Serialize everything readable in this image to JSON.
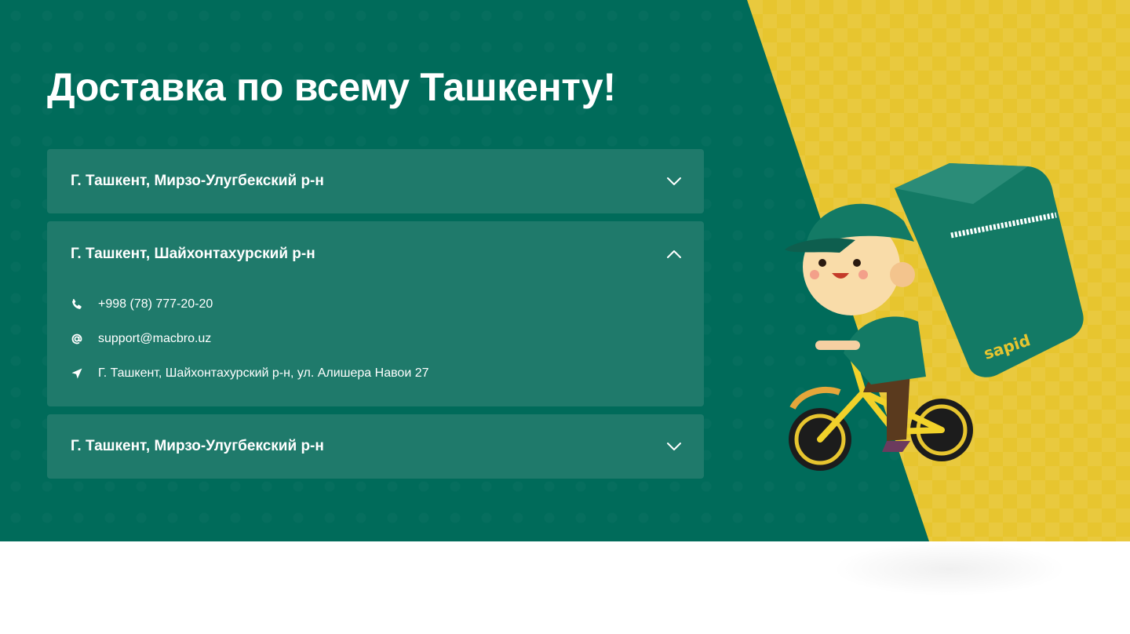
{
  "hero": {
    "title": "Доставка по всему Ташкенту!",
    "colors": {
      "background": "#006b5a",
      "card": "#1f7a6b",
      "accent": "#e7c52f"
    }
  },
  "branches": [
    {
      "title": "Г. Ташкент, Мирзо-Улугбекский р-н",
      "expanded": false,
      "toggle_icon": "chevron-down-icon"
    },
    {
      "title": "Г. Ташкент, Шайхонтахурский р-н",
      "expanded": true,
      "toggle_icon": "chevron-up-icon",
      "phone": "+998 (78) 777-20-20",
      "email": "support@macbro.uz",
      "address": "Г. Ташкент, Шайхонтахурский р-н, ул. Алишера Навои 27"
    },
    {
      "title": "Г. Ташкент, Мирзо-Улугбекский р-н",
      "expanded": false,
      "toggle_icon": "chevron-down-icon"
    }
  ],
  "illustration": {
    "bag_logo": "sapid"
  }
}
